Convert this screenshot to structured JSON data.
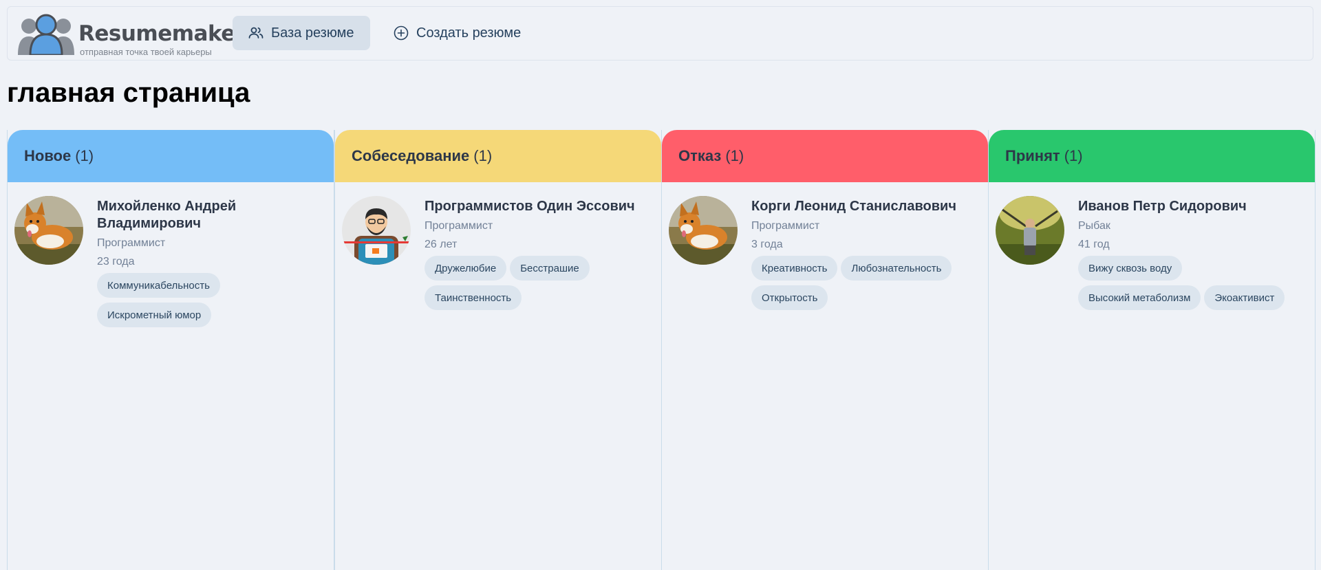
{
  "logo": {
    "word": "Resumemaker",
    "tagline": "отправная точка твоей карьеры"
  },
  "nav": {
    "database_label": "База резюме",
    "create_label": "Создать резюме"
  },
  "page_title": "главная страница",
  "columns": [
    {
      "title": "Новое",
      "count": "(1)",
      "color": "#74bdf7",
      "card": {
        "name": "Михойленко Андрей Владимирович",
        "role": "Программист",
        "age": "23 года",
        "avatar": "corgi-photo",
        "tags": [
          "Коммуникабельность",
          "Искрометный юмор"
        ]
      }
    },
    {
      "title": "Собеседование",
      "count": "(1)",
      "color": "#f5d878",
      "card": {
        "name": "Программистов Один Эссович",
        "role": "Программист",
        "age": "26 лет",
        "avatar": "programmer-illustration",
        "tags": [
          "Дружелюбие",
          "Бесстрашие",
          "Таинственность"
        ]
      }
    },
    {
      "title": "Отказ",
      "count": "(1)",
      "color": "#ff5e6a",
      "card": {
        "name": "Корги Леонид Станиславович",
        "role": "Программист",
        "age": "3 года",
        "avatar": "corgi-photo",
        "tags": [
          "Креативность",
          "Любознательность",
          "Открытость"
        ]
      }
    },
    {
      "title": "Принят",
      "count": "(1)",
      "color": "#29c76d",
      "card": {
        "name": "Иванов Петр Сидорович",
        "role": "Рыбак",
        "age": "41 год",
        "avatar": "fisherman-photo",
        "tags": [
          "Вижу сквозь воду",
          "Высокий метаболизм",
          "Экоактивист"
        ]
      }
    }
  ]
}
